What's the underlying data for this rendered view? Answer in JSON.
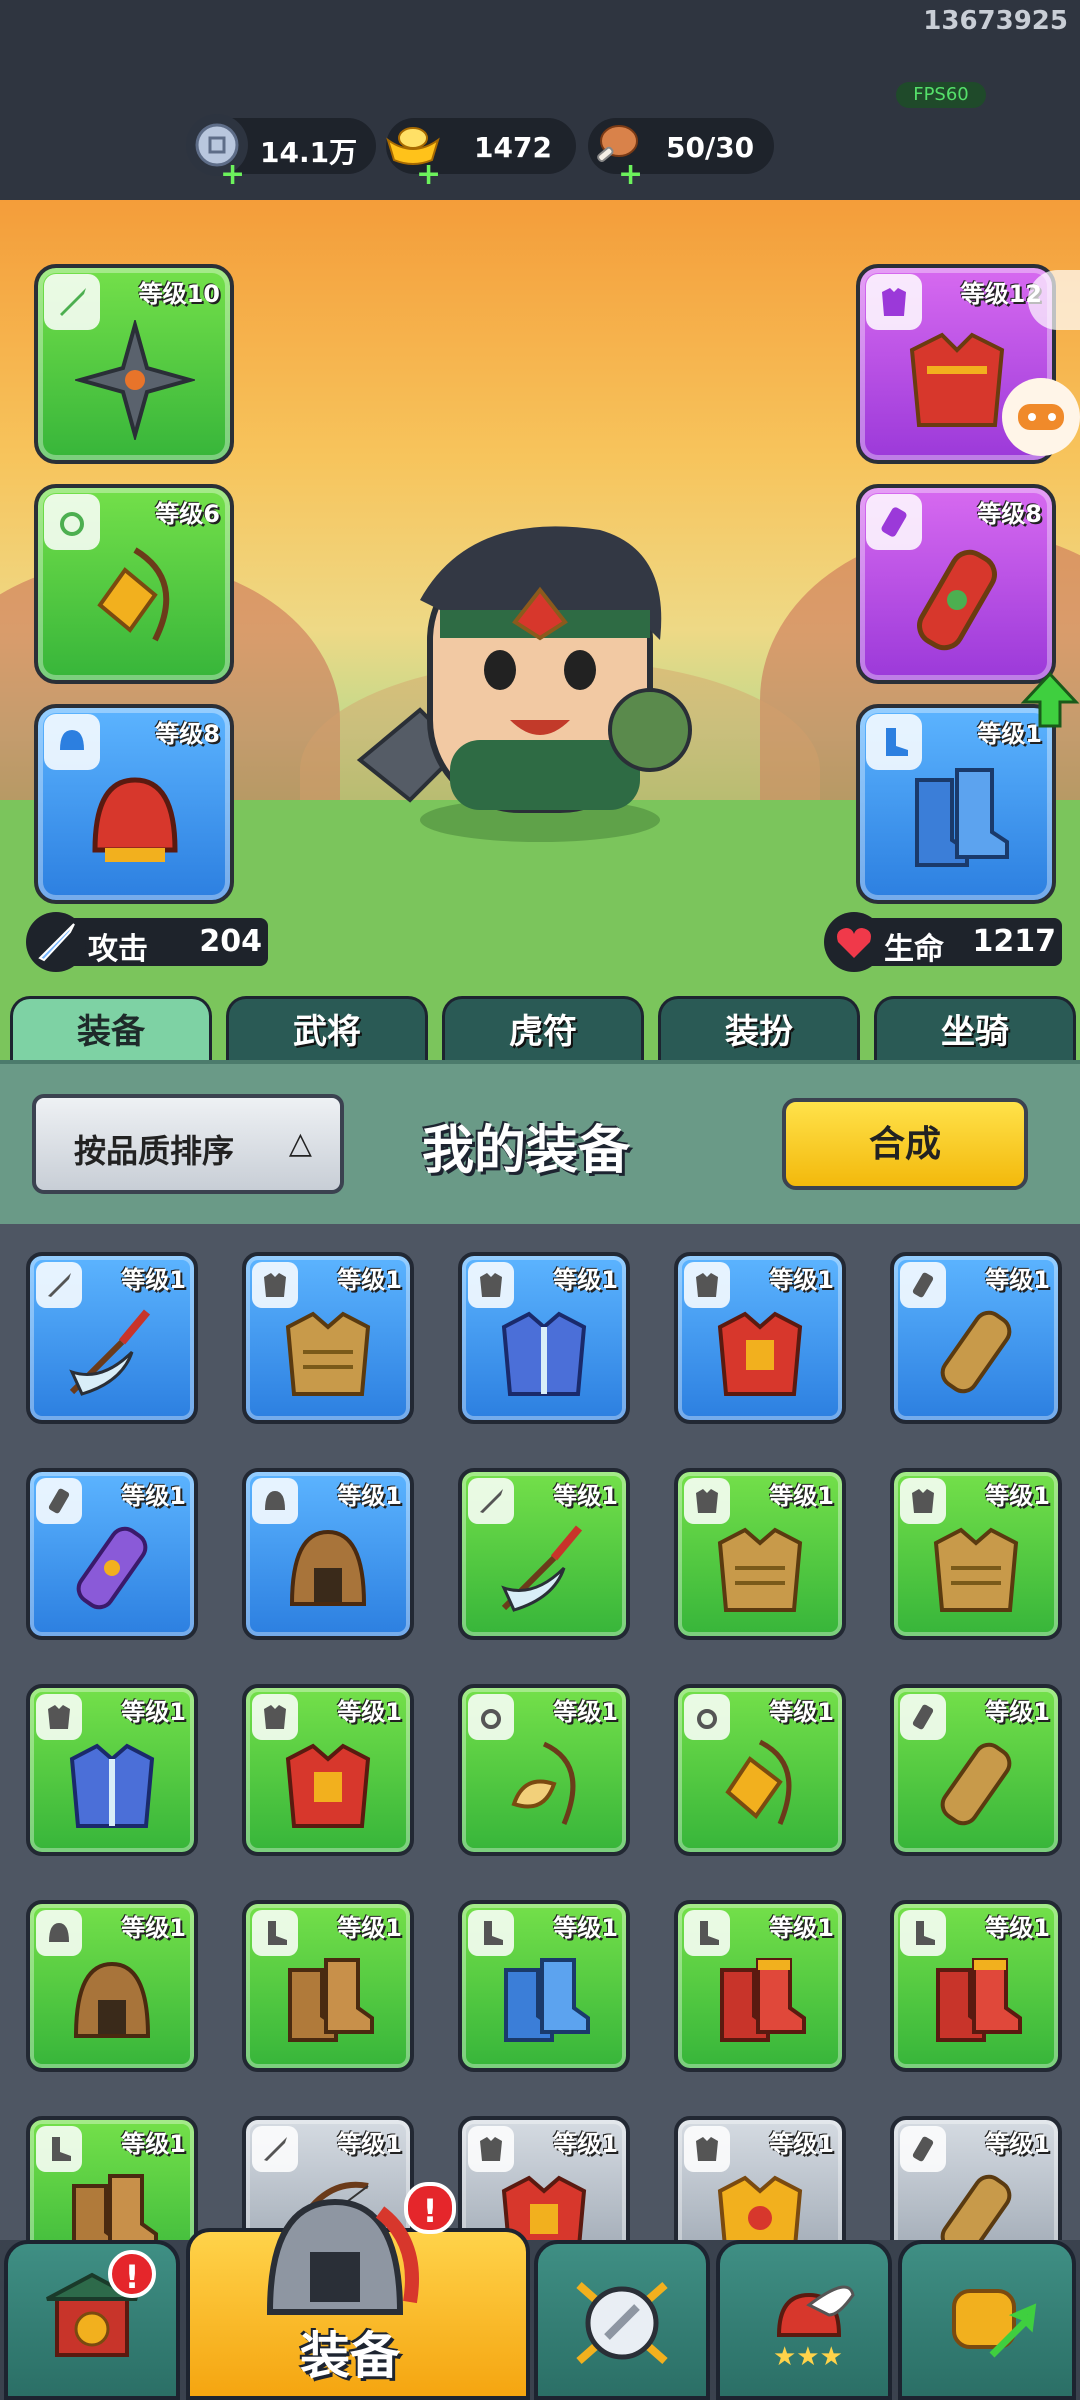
{
  "status": {
    "device_id": "13673925",
    "fps": "FPS60"
  },
  "resources": [
    {
      "name": "silver",
      "value": "14.1万",
      "icon": "silver-coin-icon",
      "color": "#9fb3d6"
    },
    {
      "name": "gold",
      "value": "1472",
      "icon": "gold-ingot-icon",
      "color": "#ffc21a"
    },
    {
      "name": "stamina",
      "value": "50/30",
      "icon": "meat-icon",
      "color": "#d9824a"
    }
  ],
  "equipped": {
    "left": [
      {
        "level": "等级10",
        "rarity": "green",
        "slot_icon": "sword-icon",
        "item": "shuriken-icon"
      },
      {
        "level": "等级6",
        "rarity": "green",
        "slot_icon": "medal-icon",
        "item": "amulet-icon"
      },
      {
        "level": "等级8",
        "rarity": "blue",
        "slot_icon": "helmet-icon",
        "item": "red-helmet-icon"
      }
    ],
    "right": [
      {
        "level": "等级12",
        "rarity": "purple",
        "slot_icon": "armor-icon",
        "item": "dragon-armor-icon"
      },
      {
        "level": "等级8",
        "rarity": "purple",
        "slot_icon": "bracer-icon",
        "item": "bracer-item-icon"
      },
      {
        "level": "等级1",
        "rarity": "blue",
        "slot_icon": "boot-icon",
        "item": "blue-boots-icon"
      }
    ]
  },
  "stats": {
    "attack_label": "攻击",
    "attack_value": "204",
    "hp_label": "生命",
    "hp_value": "1217"
  },
  "tabs": [
    "装备",
    "武将",
    "虎符",
    "装扮",
    "坐骑"
  ],
  "panel": {
    "sort_label": "按品质排序",
    "sort_arrow": "△",
    "title": "我的装备",
    "craft_label": "合成"
  },
  "inventory": [
    {
      "level": "等级1",
      "rarity": "blue",
      "slot_icon": "sword-icon",
      "item": "glaive-icon"
    },
    {
      "level": "等级1",
      "rarity": "blue",
      "slot_icon": "armor-icon",
      "item": "bronze-armor-icon"
    },
    {
      "level": "等级1",
      "rarity": "blue",
      "slot_icon": "armor-icon",
      "item": "blue-robe-icon"
    },
    {
      "level": "等级1",
      "rarity": "blue",
      "slot_icon": "armor-icon",
      "item": "red-armor-icon"
    },
    {
      "level": "等级1",
      "rarity": "blue",
      "slot_icon": "bracer-icon",
      "item": "bronze-bracer-icon"
    },
    {
      "level": "等级1",
      "rarity": "blue",
      "slot_icon": "bracer-icon",
      "item": "purple-bracer-icon"
    },
    {
      "level": "等级1",
      "rarity": "blue",
      "slot_icon": "helmet-icon",
      "item": "bronze-helmet-icon"
    },
    {
      "level": "等级1",
      "rarity": "green",
      "slot_icon": "sword-icon",
      "item": "glaive-icon"
    },
    {
      "level": "等级1",
      "rarity": "green",
      "slot_icon": "armor-icon",
      "item": "bronze-armor-icon"
    },
    {
      "level": "等级1",
      "rarity": "green",
      "slot_icon": "armor-icon",
      "item": "bronze-armor-icon"
    },
    {
      "level": "等级1",
      "rarity": "green",
      "slot_icon": "armor-icon",
      "item": "blue-robe-icon"
    },
    {
      "level": "等级1",
      "rarity": "green",
      "slot_icon": "armor-icon",
      "item": "red-armor-icon"
    },
    {
      "level": "等级1",
      "rarity": "green",
      "slot_icon": "medal-icon",
      "item": "horn-amulet-icon"
    },
    {
      "level": "等级1",
      "rarity": "green",
      "slot_icon": "medal-icon",
      "item": "amulet-icon"
    },
    {
      "level": "等级1",
      "rarity": "green",
      "slot_icon": "bracer-icon",
      "item": "bronze-bracer-icon"
    },
    {
      "level": "等级1",
      "rarity": "green",
      "slot_icon": "helmet-icon",
      "item": "bronze-helmet-icon"
    },
    {
      "level": "等级1",
      "rarity": "green",
      "slot_icon": "boot-icon",
      "item": "brown-boots-icon"
    },
    {
      "level": "等级1",
      "rarity": "green",
      "slot_icon": "boot-icon",
      "item": "blue-boots-icon"
    },
    {
      "level": "等级1",
      "rarity": "green",
      "slot_icon": "boot-icon",
      "item": "red-boots-icon"
    },
    {
      "level": "等级1",
      "rarity": "green",
      "slot_icon": "boot-icon",
      "item": "red-boots-icon"
    },
    {
      "level": "等级1",
      "rarity": "green",
      "slot_icon": "boot-icon",
      "item": "brown-boots-icon"
    },
    {
      "level": "等级1",
      "rarity": "gray",
      "slot_icon": "sword-icon",
      "item": "bow-icon"
    },
    {
      "level": "等级1",
      "rarity": "gray",
      "slot_icon": "armor-icon",
      "item": "red-armor-icon"
    },
    {
      "level": "等级1",
      "rarity": "gray",
      "slot_icon": "armor-icon",
      "item": "gold-armor-icon"
    },
    {
      "level": "等级1",
      "rarity": "gray",
      "slot_icon": "bracer-icon",
      "item": "bronze-bracer-icon"
    }
  ],
  "bottom_nav": {
    "items": [
      {
        "name": "shop",
        "icon": "gate-icon",
        "badge": "!"
      },
      {
        "name": "equipment",
        "icon": "helmet-icon",
        "label": "装备",
        "badge": "!"
      },
      {
        "name": "battle",
        "icon": "shield-swords-icon"
      },
      {
        "name": "heroes",
        "icon": "winged-helmet-icon"
      },
      {
        "name": "upgrade",
        "icon": "fist-icon"
      }
    ]
  }
}
